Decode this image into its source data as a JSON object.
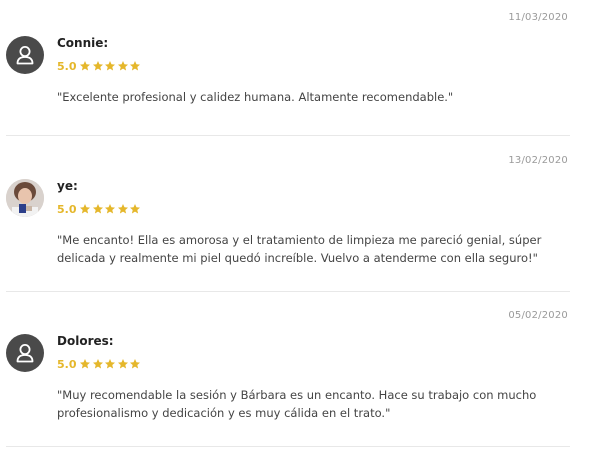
{
  "rating_color": "#e5b72b",
  "reviews": [
    {
      "date": "11/03/2020",
      "author": "Connie:",
      "avatar": "default-user-icon",
      "rating": "5.0",
      "stars": 5,
      "text": "\"Excelente profesional y calidez humana. Altamente recomendable.\""
    },
    {
      "date": "13/02/2020",
      "author": "ye:",
      "avatar": "user-photo",
      "rating": "5.0",
      "stars": 5,
      "text": "\"Me encanto! Ella es amorosa y el tratamiento de limpieza me pareció genial, súper delicada y realmente mi piel quedó increíble. Vuelvo a atenderme con ella seguro!\""
    },
    {
      "date": "05/02/2020",
      "author": "Dolores:",
      "avatar": "default-user-icon",
      "rating": "5.0",
      "stars": 5,
      "text": "\"Muy recomendable la sesión y Bárbara es un encanto. Hace su trabajo con mucho profesionalismo y dedicación y es muy cálida en el trato.\""
    }
  ]
}
